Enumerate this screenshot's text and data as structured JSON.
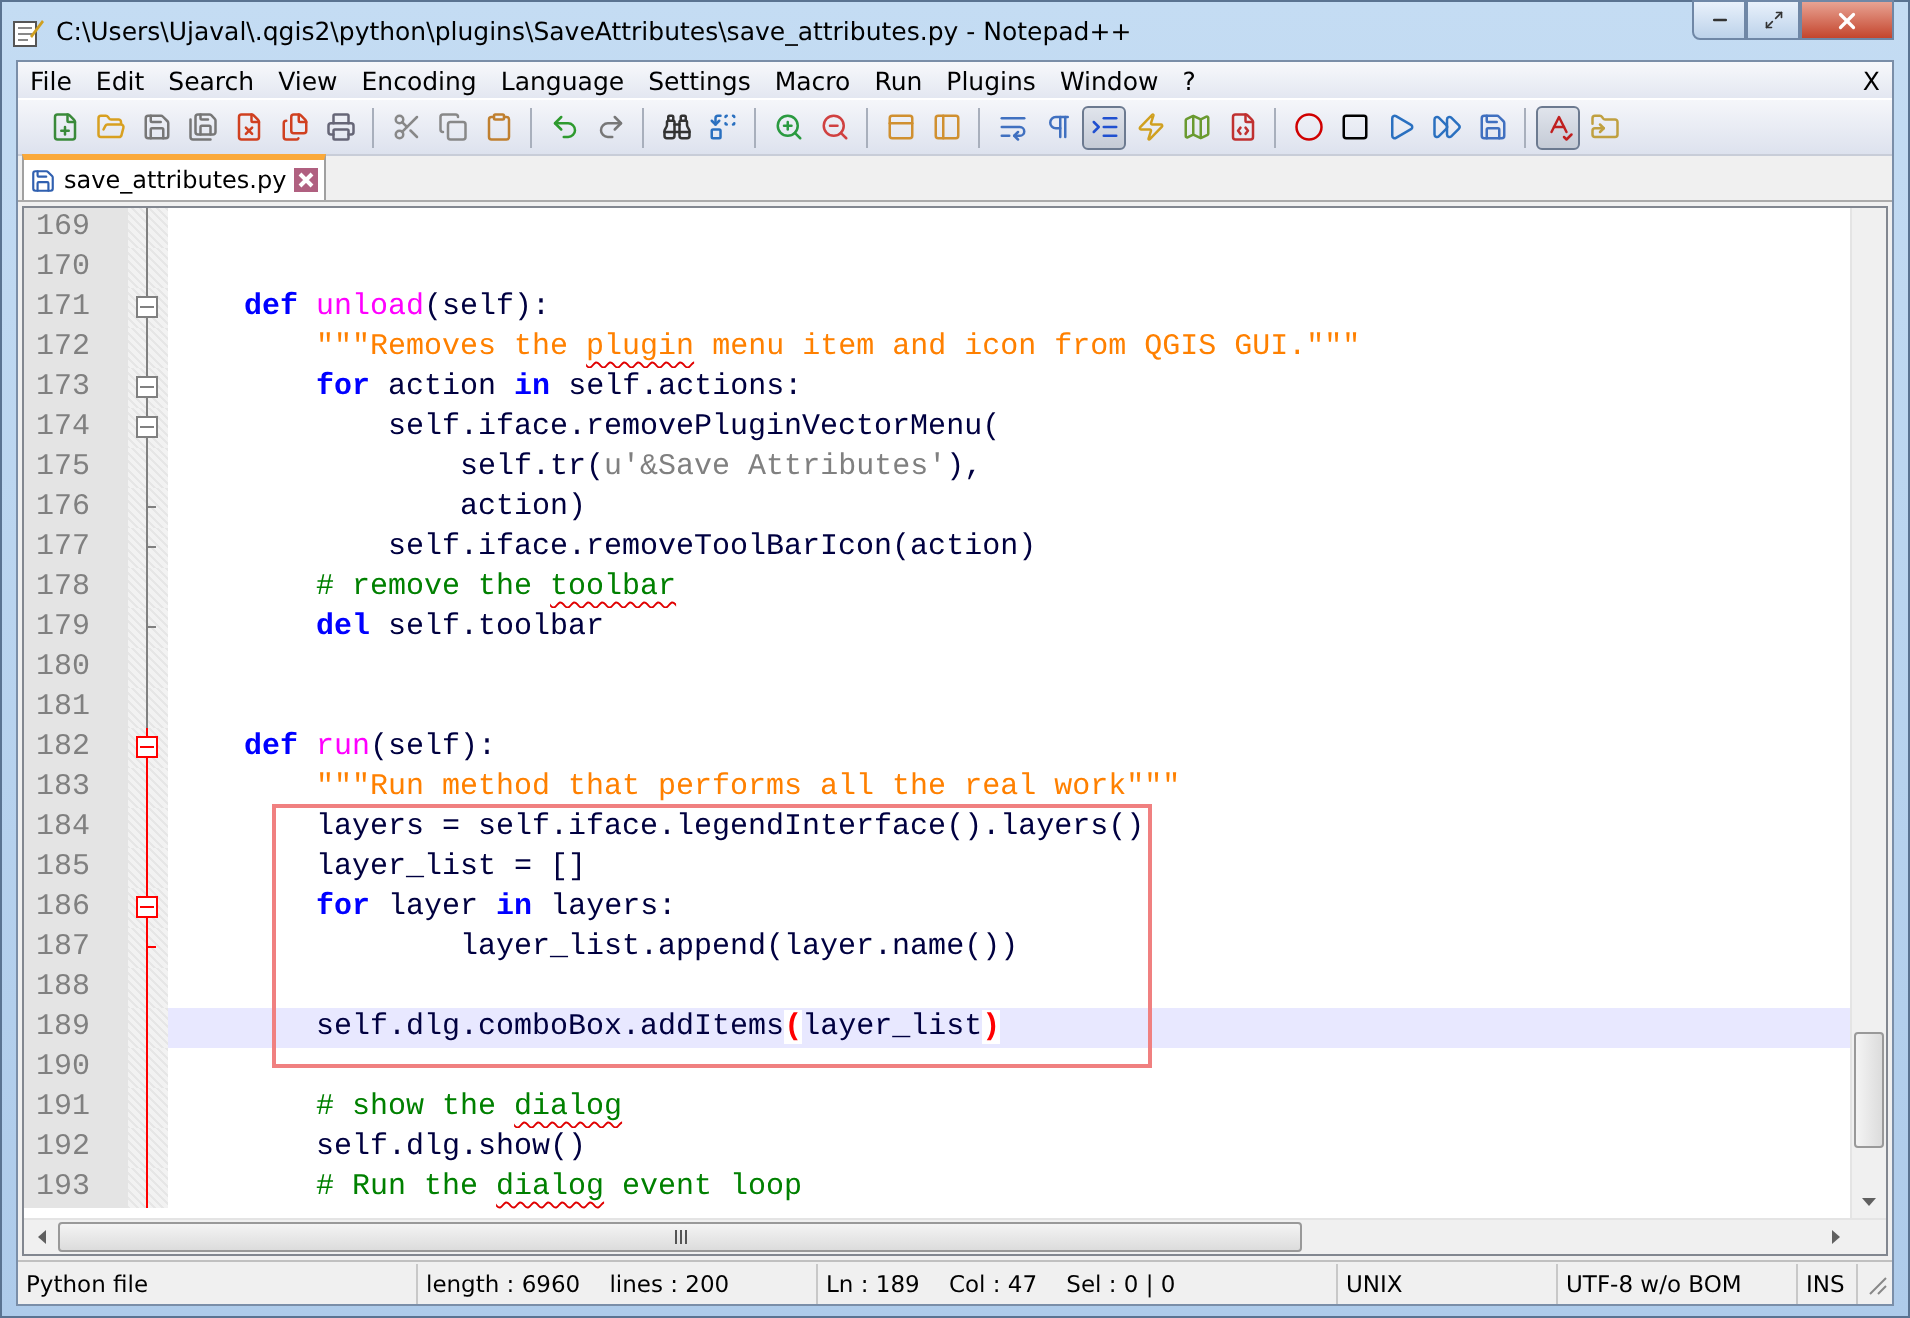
{
  "window": {
    "title": "C:\\Users\\Ujaval\\.qgis2\\python\\plugins\\SaveAttributes\\save_attributes.py - Notepad++"
  },
  "menu": [
    {
      "label": "File"
    },
    {
      "label": "Edit"
    },
    {
      "label": "Search"
    },
    {
      "label": "View"
    },
    {
      "label": "Encoding"
    },
    {
      "label": "Language"
    },
    {
      "label": "Settings"
    },
    {
      "label": "Macro"
    },
    {
      "label": "Run"
    },
    {
      "label": "Plugins"
    },
    {
      "label": "Window"
    },
    {
      "label": "?"
    }
  ],
  "menu_close": "X",
  "toolbar": [
    {
      "pressed": false
    },
    {
      "pressed": false
    },
    {
      "pressed": false
    },
    {
      "pressed": false
    },
    {
      "pressed": false
    },
    {
      "pressed": false
    },
    {
      "pressed": false
    },
    {
      "pressed": false
    },
    {
      "pressed": false
    },
    {
      "pressed": false
    },
    {
      "pressed": false
    },
    {
      "pressed": false
    },
    {
      "pressed": false
    },
    {
      "pressed": false
    },
    {
      "pressed": false
    },
    {
      "pressed": false
    },
    {
      "pressed": false
    },
    {
      "pressed": false
    },
    {
      "pressed": false
    },
    {
      "pressed": false
    },
    {
      "pressed": true
    },
    {
      "pressed": false
    },
    {
      "pressed": false
    },
    {
      "pressed": false
    },
    {
      "pressed": false
    },
    {
      "pressed": false
    },
    {
      "pressed": false
    },
    {
      "pressed": false
    },
    {
      "pressed": false
    },
    {
      "pressed": true
    },
    {
      "pressed": false
    }
  ],
  "tabs": [
    {
      "label": "save_attributes.py",
      "selected": true
    }
  ],
  "editor": {
    "lines": [
      {
        "num": "169",
        "kind": "fold_line",
        "active_block": false,
        "current": false
      },
      {
        "num": "170",
        "kind": "fold_line",
        "active_block": false,
        "current": false
      },
      {
        "num": "171",
        "kind": "fold_open",
        "active_block": false,
        "current": false,
        "tokens": [
          {
            "t": "    def ",
            "kind": "keyword"
          },
          {
            "t": "unload",
            "kind": "function"
          },
          {
            "t": "(self):",
            "kind": "plain"
          }
        ]
      },
      {
        "num": "172",
        "kind": "fold_line",
        "active_block": false,
        "current": false,
        "tokens": [
          {
            "t": "        \"\"\"Removes the ",
            "kind": "string"
          },
          {
            "t": "plugin",
            "kind": "string",
            "spell": true
          },
          {
            "t": " menu item and icon from QGIS GUI.\"\"\"",
            "kind": "string"
          }
        ]
      },
      {
        "num": "173",
        "kind": "fold_open",
        "active_block": false,
        "current": false,
        "tokens": [
          {
            "t": "        for",
            "kind": "keyword"
          },
          {
            "t": " action ",
            "kind": "plain"
          },
          {
            "t": "in",
            "kind": "keyword"
          },
          {
            "t": " self.actions:",
            "kind": "plain"
          }
        ]
      },
      {
        "num": "174",
        "kind": "fold_open",
        "active_block": false,
        "current": false,
        "tokens": [
          {
            "t": "            self.iface.removePluginVectorMenu(",
            "kind": "plain"
          }
        ]
      },
      {
        "num": "175",
        "kind": "fold_line",
        "active_block": false,
        "current": false,
        "tokens": [
          {
            "t": "                self.tr(",
            "kind": "plain"
          },
          {
            "t": "u'&Save Attributes'",
            "kind": "literal"
          },
          {
            "t": "),",
            "kind": "plain"
          }
        ]
      },
      {
        "num": "176",
        "kind": "fold_end",
        "active_block": false,
        "current": false,
        "tokens": [
          {
            "t": "                action)",
            "kind": "plain"
          }
        ]
      },
      {
        "num": "177",
        "kind": "fold_end",
        "active_block": false,
        "current": false,
        "tokens": [
          {
            "t": "            self.iface.removeToolBarIcon(action)",
            "kind": "plain"
          }
        ]
      },
      {
        "num": "178",
        "kind": "fold_line",
        "active_block": false,
        "current": false,
        "tokens": [
          {
            "t": "        # remove the ",
            "kind": "comment"
          },
          {
            "t": "toolbar",
            "kind": "comment",
            "spell": true
          }
        ]
      },
      {
        "num": "179",
        "kind": "fold_end",
        "active_block": false,
        "current": false,
        "tokens": [
          {
            "t": "        del",
            "kind": "keyword"
          },
          {
            "t": " self.toolbar",
            "kind": "plain"
          }
        ]
      },
      {
        "num": "180",
        "kind": "fold_line",
        "active_block": false,
        "current": false
      },
      {
        "num": "181",
        "kind": "fold_line",
        "active_block": false,
        "current": false
      },
      {
        "num": "182",
        "kind": "fold_open",
        "active_block": true,
        "current": false,
        "tokens": [
          {
            "t": "    def ",
            "kind": "keyword"
          },
          {
            "t": "run",
            "kind": "function"
          },
          {
            "t": "(self):",
            "kind": "plain"
          }
        ]
      },
      {
        "num": "183",
        "kind": "fold_line",
        "active_block": true,
        "current": false,
        "tokens": [
          {
            "t": "        \"\"\"Run method that performs all the real work\"\"\"",
            "kind": "string"
          }
        ]
      },
      {
        "num": "184",
        "kind": "fold_line",
        "active_block": true,
        "current": false,
        "tokens": [
          {
            "t": "        layers = self.iface.legendInterface().layers()",
            "kind": "plain"
          }
        ]
      },
      {
        "num": "185",
        "kind": "fold_line",
        "active_block": true,
        "current": false,
        "tokens": [
          {
            "t": "        layer_list = []",
            "kind": "plain"
          }
        ]
      },
      {
        "num": "186",
        "kind": "fold_open",
        "active_block": true,
        "current": false,
        "tokens": [
          {
            "t": "        for",
            "kind": "keyword"
          },
          {
            "t": " layer ",
            "kind": "plain"
          },
          {
            "t": "in",
            "kind": "keyword"
          },
          {
            "t": " layers:",
            "kind": "plain"
          }
        ]
      },
      {
        "num": "187",
        "kind": "fold_end",
        "active_block": true,
        "current": false,
        "tokens": [
          {
            "t": "                layer_list.append(layer.name())",
            "kind": "plain"
          }
        ]
      },
      {
        "num": "188",
        "kind": "fold_line",
        "active_block": true,
        "current": false
      },
      {
        "num": "189",
        "kind": "fold_line",
        "active_block": true,
        "current": true,
        "tokens": [
          {
            "t": "        self.dlg.comboBox.addItems",
            "kind": "plain"
          },
          {
            "t": "(",
            "kind": "brace"
          },
          {
            "t": "layer_list",
            "kind": "plain"
          },
          {
            "t": ")",
            "kind": "brace"
          }
        ]
      },
      {
        "num": "190",
        "kind": "fold_line",
        "active_block": true,
        "current": false
      },
      {
        "num": "191",
        "kind": "fold_line",
        "active_block": true,
        "current": false,
        "tokens": [
          {
            "t": "        # show the ",
            "kind": "comment"
          },
          {
            "t": "dialog",
            "kind": "comment",
            "spell": true
          }
        ]
      },
      {
        "num": "192",
        "kind": "fold_line",
        "active_block": true,
        "current": false,
        "tokens": [
          {
            "t": "        self.dlg.show()",
            "kind": "plain"
          }
        ]
      },
      {
        "num": "193",
        "kind": "fold_line",
        "active_block": true,
        "current": false,
        "tokens": [
          {
            "t": "        # Run the ",
            "kind": "comment"
          },
          {
            "t": "dialog",
            "kind": "comment",
            "spell": true
          },
          {
            "t": " event loop",
            "kind": "comment"
          }
        ]
      }
    ]
  },
  "status_bar": [
    {
      "text": "Python file"
    },
    {
      "text": "length : 6960    lines : 200"
    },
    {
      "text": "Ln : 189    Col : 47    Sel : 0 | 0"
    },
    {
      "text": "UNIX"
    },
    {
      "text": "UTF-8 w/o BOM"
    },
    {
      "text": "INS"
    }
  ]
}
